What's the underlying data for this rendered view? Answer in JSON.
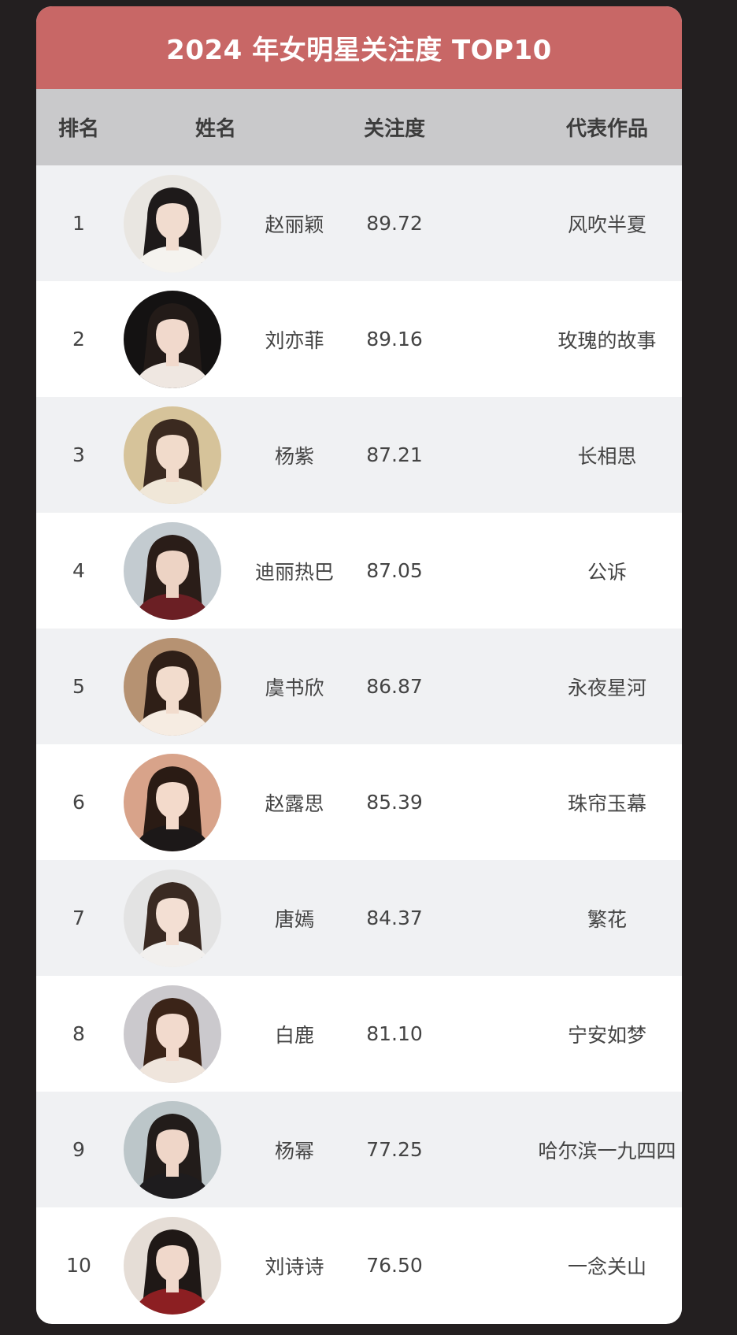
{
  "title": "2024 年女明星关注度 TOP10",
  "headers": {
    "rank": "排名",
    "name": "姓名",
    "score": "关注度",
    "work": "代表作品"
  },
  "rows": [
    {
      "rank": "1",
      "name": "赵丽颖",
      "score": "89.72",
      "work": "风吹半夏",
      "bg": "#e9e6e1",
      "hair": "#1e1a1a",
      "skin": "#f1dccf",
      "cloth": "#f5f3ef"
    },
    {
      "rank": "2",
      "name": "刘亦菲",
      "score": "89.16",
      "work": "玫瑰的故事",
      "bg": "#141212",
      "hair": "#231b18",
      "skin": "#f1d9cc",
      "cloth": "#efe7e1"
    },
    {
      "rank": "3",
      "name": "杨紫",
      "score": "87.21",
      "work": "长相思",
      "bg": "#d6c39a",
      "hair": "#3b2a20",
      "skin": "#f1dbcb",
      "cloth": "#f0e7d8"
    },
    {
      "rank": "4",
      "name": "迪丽热巴",
      "score": "87.05",
      "work": "公诉",
      "bg": "#c3cbd0",
      "hair": "#2a1d18",
      "skin": "#edd3c4",
      "cloth": "#6b1f24"
    },
    {
      "rank": "5",
      "name": "虞书欣",
      "score": "86.87",
      "work": "永夜星河",
      "bg": "#b69272",
      "hair": "#2f1f17",
      "skin": "#f2dccd",
      "cloth": "#f6ece2"
    },
    {
      "rank": "6",
      "name": "赵露思",
      "score": "85.39",
      "work": "珠帘玉幕",
      "bg": "#d8a38a",
      "hair": "#2a1b14",
      "skin": "#f3dacb",
      "cloth": "#1c1818"
    },
    {
      "rank": "7",
      "name": "唐嫣",
      "score": "84.37",
      "work": "繁花",
      "bg": "#e3e3e3",
      "hair": "#3a2a22",
      "skin": "#f3dfd3",
      "cloth": "#f2f0ee"
    },
    {
      "rank": "8",
      "name": "白鹿",
      "score": "81.10",
      "work": "宁安如梦",
      "bg": "#cbc9cd",
      "hair": "#3b2418",
      "skin": "#f2dacd",
      "cloth": "#efe5dc"
    },
    {
      "rank": "9",
      "name": "杨幂",
      "score": "77.25",
      "work": "哈尔滨一九四四",
      "bg": "#bcc6c9",
      "hair": "#221c1a",
      "skin": "#efd6c8",
      "cloth": "#1e1c1e"
    },
    {
      "rank": "10",
      "name": "刘诗诗",
      "score": "76.50",
      "work": "一念关山",
      "bg": "#e5ddd6",
      "hair": "#1f1816",
      "skin": "#f0d8cb",
      "cloth": "#8c1f22"
    }
  ],
  "colors": {
    "title_bar": "#c86766",
    "header_bg": "#c9c9cb",
    "row_odd": "#f0f1f3",
    "row_even": "#ffffff",
    "page_bg": "#231f20"
  }
}
